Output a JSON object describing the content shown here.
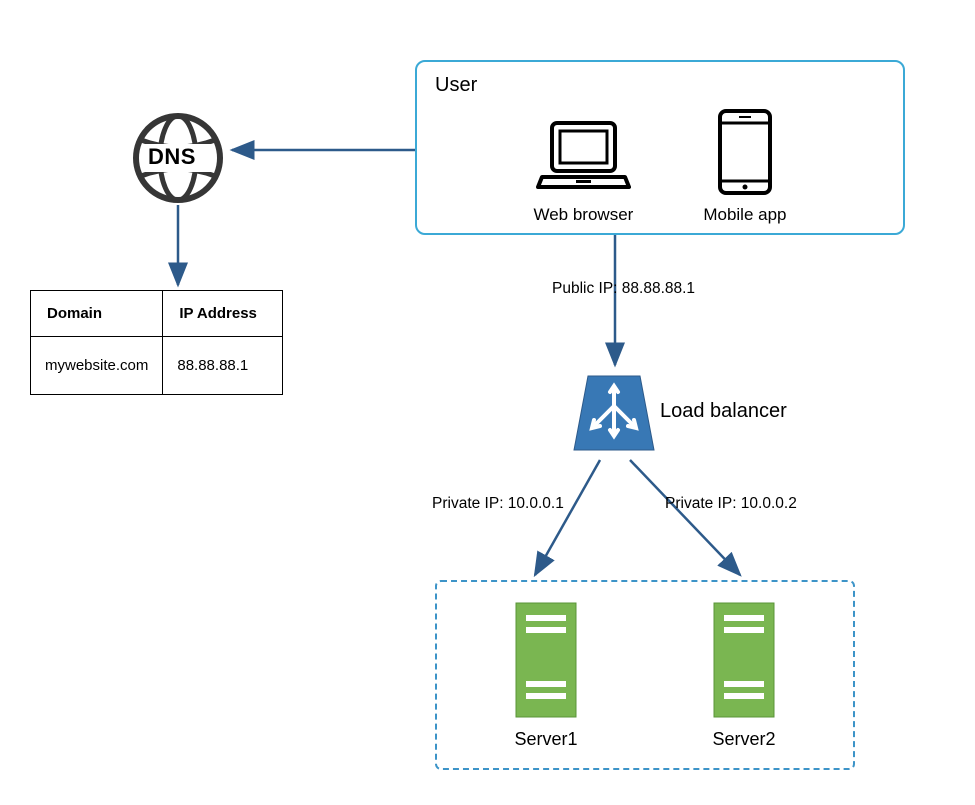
{
  "user": {
    "title": "User",
    "web_label": "Web browser",
    "mobile_label": "Mobile app"
  },
  "dns": {
    "label": "DNS"
  },
  "table": {
    "headers": {
      "domain": "Domain",
      "ip": "IP Address"
    },
    "row": {
      "domain": "mywebsite.com",
      "ip": "88.88.88.1"
    }
  },
  "load_balancer": {
    "label": "Load balancer"
  },
  "servers": {
    "s1": "Server1",
    "s2": "Server2"
  },
  "edges": {
    "public_ip": "Public IP: 88.88.88.1",
    "private_ip1": "Private IP: 10.0.0.1",
    "private_ip2": "Private IP: 10.0.0.2"
  }
}
